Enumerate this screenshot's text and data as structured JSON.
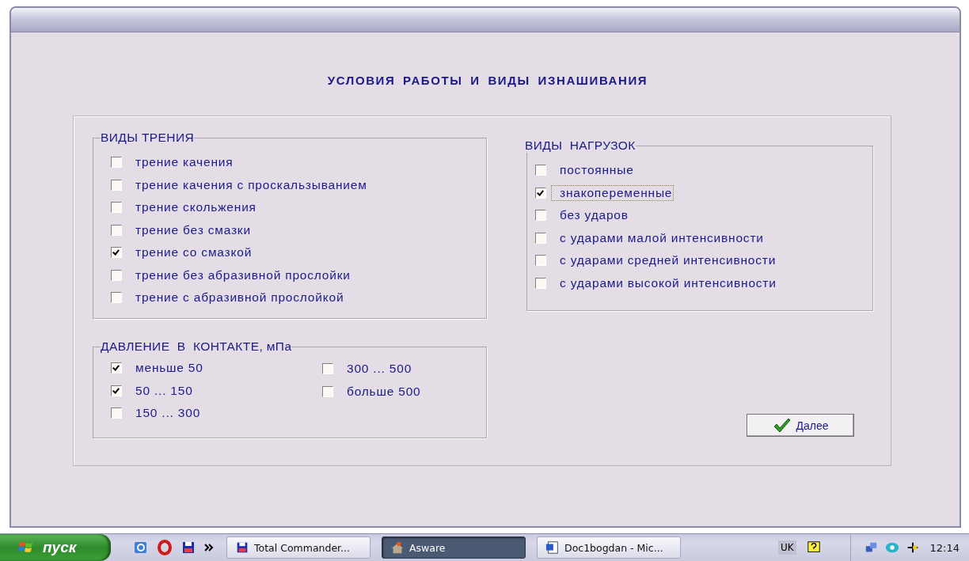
{
  "window": {
    "heading": "УСЛОВИЯ РАБОТЫ И ВИДЫ ИЗНАШИВАНИЯ"
  },
  "friction": {
    "title": "ВИДЫ ТРЕНИЯ",
    "items": [
      {
        "label": "трение качения",
        "checked": false
      },
      {
        "label": "трение качения с проскальзыванием",
        "checked": false
      },
      {
        "label": "трение скольжения",
        "checked": false
      },
      {
        "label": "трение без смазки",
        "checked": false
      },
      {
        "label": "трение со смазкой",
        "checked": true
      },
      {
        "label": "трение без абразивной прослойки",
        "checked": false
      },
      {
        "label": "трение с абразивной прослойкой",
        "checked": false
      }
    ]
  },
  "pressure": {
    "title": "ДАВЛЕНИЕ  В  КОНТАКТЕ, мПа",
    "columns": [
      [
        {
          "label": "меньше 50",
          "checked": true
        },
        {
          "label": "50 ... 150",
          "checked": true
        },
        {
          "label": "150 ... 300",
          "checked": false
        }
      ],
      [
        {
          "label": "300 ... 500",
          "checked": false
        },
        {
          "label": "больше 500",
          "checked": false
        }
      ]
    ]
  },
  "loads": {
    "title": "ВИДЫ  НАГРУЗОК",
    "items": [
      {
        "label": "постоянные",
        "checked": false,
        "focused": false
      },
      {
        "label": "знакопеременные",
        "checked": true,
        "focused": true
      },
      {
        "label": "без ударов",
        "checked": false,
        "focused": false
      },
      {
        "label": "с ударами малой интенсивности",
        "checked": false,
        "focused": false
      },
      {
        "label": "с ударами средней интенсивности",
        "checked": false,
        "focused": false
      },
      {
        "label": "с ударами высокой интенсивности",
        "checked": false,
        "focused": false
      }
    ]
  },
  "next_button": {
    "label": "Далее"
  },
  "taskbar": {
    "start": "пуск",
    "tasks": [
      {
        "label": "Total Commander...",
        "selected": false,
        "kind": "disk"
      },
      {
        "label": "Asware",
        "selected": true,
        "kind": "app"
      },
      {
        "label": "Doc1bogdan - Mic...",
        "selected": false,
        "kind": "doc"
      }
    ],
    "language": "UK",
    "time": "12:14"
  }
}
